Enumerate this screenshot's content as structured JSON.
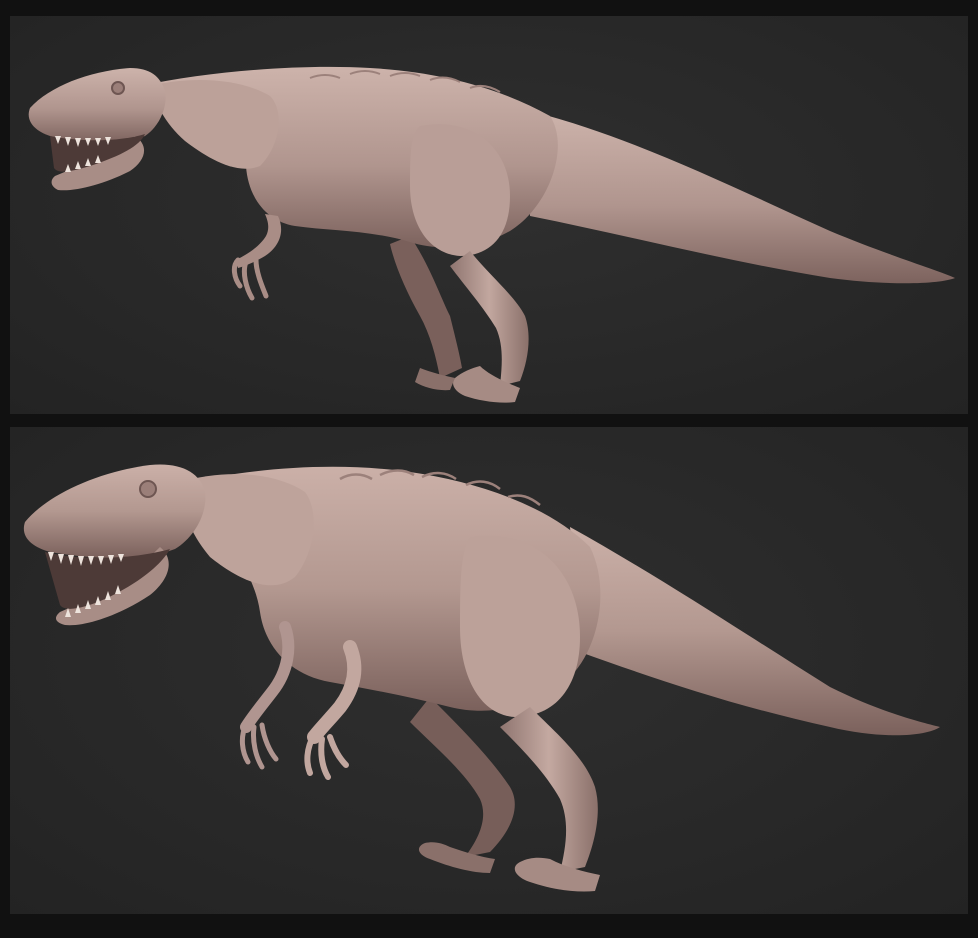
{
  "image": {
    "panels": [
      {
        "id": "side-view",
        "subject": "dinosaur-sculpt-side-view"
      },
      {
        "id": "three-quarter-view",
        "subject": "dinosaur-sculpt-three-quarter-view"
      }
    ],
    "colors": {
      "background": "#111111",
      "panel": "#2a2a2a",
      "skin_light": "#c9aea6",
      "skin_mid": "#a98d86",
      "skin_shadow": "#6e5652",
      "teeth": "#ede3dc"
    }
  }
}
